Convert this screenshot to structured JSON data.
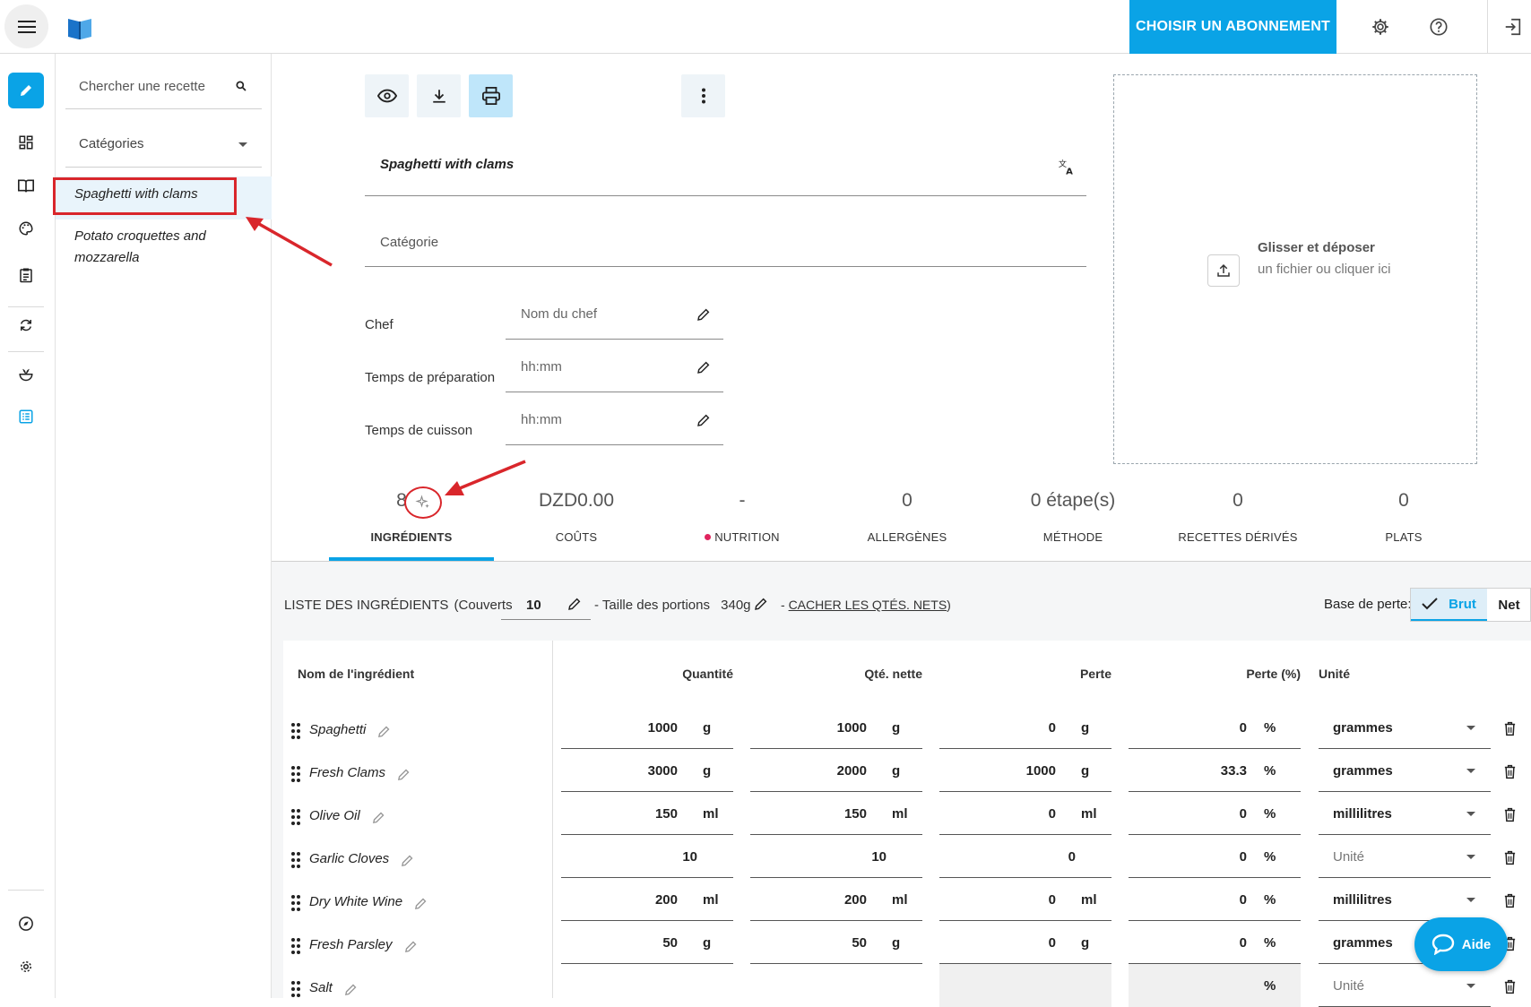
{
  "topbar": {
    "subscribe_label": "CHOISIR UN ABONNEMENT"
  },
  "recipes_panel": {
    "search_placeholder": "Chercher une recette",
    "categories_label": "Catégories",
    "recipes": [
      "Spaghetti with clams",
      "Potato croquettes and mozzarella"
    ]
  },
  "recipe": {
    "title": "Spaghetti with clams",
    "category_placeholder": "Catégorie",
    "chef_label": "Chef",
    "chef_placeholder": "Nom du chef",
    "prep_label": "Temps de préparation",
    "prep_placeholder": "hh:mm",
    "cook_label": "Temps de cuisson",
    "cook_placeholder": "hh:mm"
  },
  "dropzone": {
    "title": "Glisser et déposer",
    "subtitle": "un fichier ou cliquer ici"
  },
  "stats": [
    {
      "value": "8",
      "label": "INGRÉDIENTS"
    },
    {
      "value": "DZD0.00",
      "label": "COÛTS"
    },
    {
      "value": "-",
      "label": "NUTRITION"
    },
    {
      "value": "0",
      "label": "ALLERGÈNES"
    },
    {
      "value": "0 étape(s)",
      "label": "MÉTHODE"
    },
    {
      "value": "0",
      "label": "RECETTES DÉRIVÉS"
    },
    {
      "value": "0",
      "label": "PLATS"
    }
  ],
  "ingredients_header": {
    "title": "LISTE DES INGRÉDIENTS",
    "couverts_label": "(Couverts",
    "couverts_value": "10",
    "portion_label": "- Taille des portions",
    "portion_value": "340g",
    "hide_prefix": "- ",
    "hide_link": "CACHER LES QTÉS. NETS",
    "hide_suffix": ")",
    "loss_base_label": "Base de perte:",
    "brut_label": "Brut",
    "net_label": "Net"
  },
  "table": {
    "columns": [
      "Nom de l'ingrédient",
      "Quantité",
      "Qté. nette",
      "Perte",
      "Perte (%)",
      "Unité"
    ],
    "rows": [
      {
        "name": "Spaghetti",
        "qty": "1000",
        "qty_unit": "g",
        "net": "1000",
        "net_unit": "g",
        "loss": "0",
        "loss_unit": "g",
        "loss_pct": "0",
        "unit": "grammes"
      },
      {
        "name": "Fresh Clams",
        "qty": "3000",
        "qty_unit": "g",
        "net": "2000",
        "net_unit": "g",
        "loss": "1000",
        "loss_unit": "g",
        "loss_pct": "33.3",
        "unit": "grammes"
      },
      {
        "name": "Olive Oil",
        "qty": "150",
        "qty_unit": "ml",
        "net": "150",
        "net_unit": "ml",
        "loss": "0",
        "loss_unit": "ml",
        "loss_pct": "0",
        "unit": "millilitres"
      },
      {
        "name": "Garlic Cloves",
        "qty": "10",
        "qty_unit": "",
        "net": "10",
        "net_unit": "",
        "loss": "0",
        "loss_unit": "",
        "loss_pct": "0",
        "unit": "Unité"
      },
      {
        "name": "Dry White Wine",
        "qty": "200",
        "qty_unit": "ml",
        "net": "200",
        "net_unit": "ml",
        "loss": "0",
        "loss_unit": "ml",
        "loss_pct": "0",
        "unit": "millilitres"
      },
      {
        "name": "Fresh Parsley",
        "qty": "50",
        "qty_unit": "g",
        "net": "50",
        "net_unit": "g",
        "loss": "0",
        "loss_unit": "g",
        "loss_pct": "0",
        "unit": "grammes"
      },
      {
        "name": "Salt",
        "qty": "",
        "qty_unit": "",
        "net": "",
        "net_unit": "",
        "loss": "",
        "loss_unit": "",
        "loss_pct": "",
        "unit": "Unité"
      }
    ],
    "pct_symbol": "%"
  },
  "help": {
    "label": "Aide"
  },
  "colors": {
    "accent": "#0aa3e6",
    "annotation": "#d9262b",
    "nutrition_dot": "#e0245e"
  }
}
